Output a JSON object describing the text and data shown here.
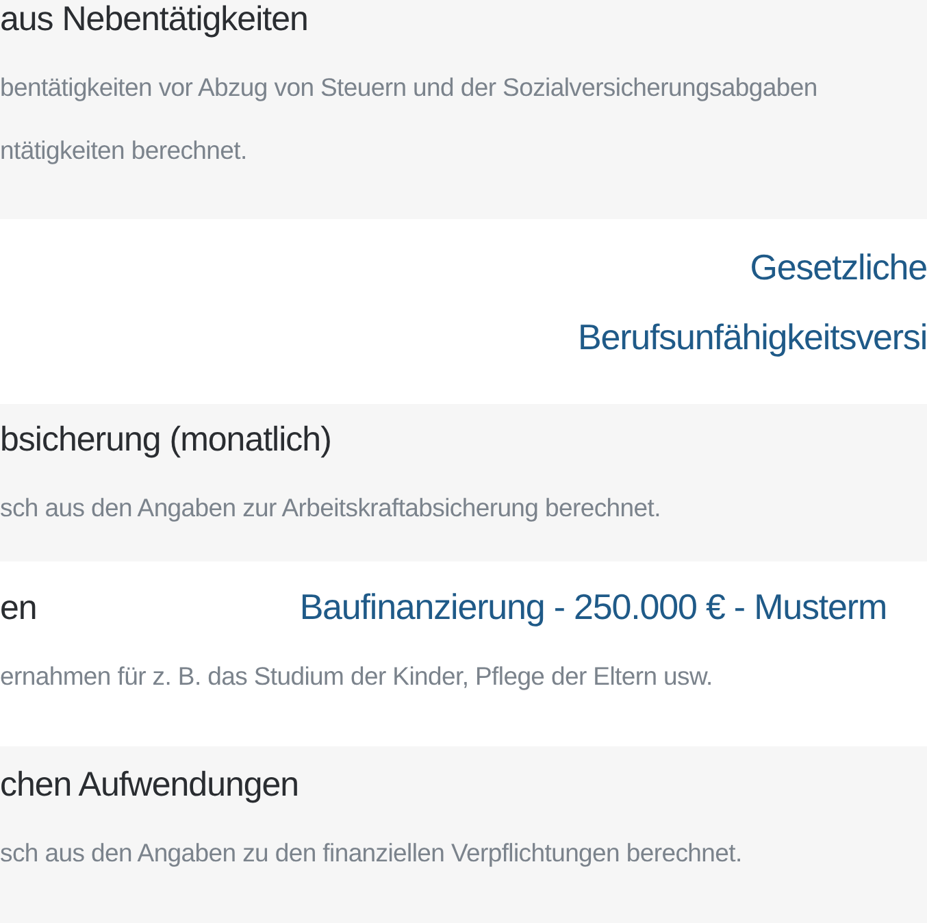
{
  "sections": [
    {
      "title": "aus Nebentätigkeiten",
      "description": [
        "bentätigkeiten vor Abzug von Steuern und der Sozialversicherungsabgaben",
        "ntätigkeiten berechnet."
      ]
    },
    {
      "links": [
        "Gesetzliche",
        "Berufsunfähigkeitsversi"
      ]
    },
    {
      "title": "bsicherung (monatlich)",
      "description": [
        "sch aus den Angaben zur Arbeitskraftabsicherung berechnet."
      ]
    },
    {
      "title": "en",
      "links": [
        "Baufinanzierung - 250.000 € - Musterm"
      ],
      "description": [
        "ernahmen für z. B. das Studium der Kinder, Pflege der Eltern usw."
      ]
    },
    {
      "title": "chen Aufwendungen",
      "description": [
        "sch aus den Angaben zu den finanziellen Verpflichtungen berechnet."
      ]
    }
  ]
}
